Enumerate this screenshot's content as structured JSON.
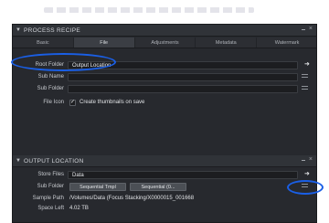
{
  "process_recipe": {
    "title": "PROCESS RECIPE",
    "tabs": [
      "Basic",
      "File",
      "Adjustments",
      "Metadata",
      "Watermark"
    ],
    "active_tab": "File",
    "rows": [
      {
        "label": "Root Folder",
        "value": "Output Location"
      },
      {
        "label": "Sub Name",
        "value": ""
      },
      {
        "label": "Sub Folder",
        "value": ""
      }
    ],
    "file_icon": {
      "label": "File Icon",
      "checkbox": "✓",
      "text": "Create thumbnails on save"
    }
  },
  "output_location": {
    "title": "OUTPUT LOCATION",
    "store_files": {
      "label": "Store Files",
      "value": "Data"
    },
    "sub_folder": {
      "label": "Sub Folder",
      "buttons": [
        "Sequential Tmpl",
        "Sequential (0..."
      ]
    },
    "sample_path": {
      "label": "Sample Path",
      "value": "/Volumes/Data (Focus Stacking/X0000015_001668"
    },
    "space_left": {
      "label": "Space Left",
      "value": "4.02 TB"
    }
  },
  "annotation_color": "#1a5fe6",
  "icons": {
    "collapse": "chevron-down-icon",
    "close": "close-icon",
    "menu": "hamburger-menu-icon",
    "arrow": "arrow-right-icon"
  }
}
